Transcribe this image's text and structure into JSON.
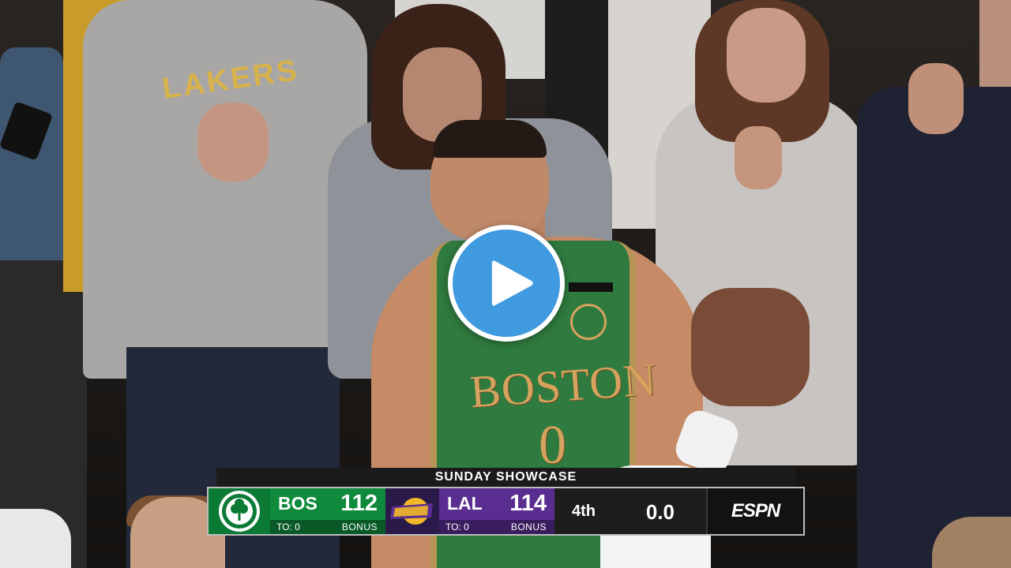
{
  "video": {
    "crowd_shirt_text": "LAKERS",
    "jersey_text": "BOSTON",
    "jersey_number": "0"
  },
  "player_controls": {
    "play_icon": "play-icon",
    "play_button_color": "#3f9adf"
  },
  "scoreboard": {
    "title": "SUNDAY SHOWCASE",
    "away": {
      "abbr": "BOS",
      "score": "112",
      "timeouts": "TO: 0",
      "bonus": "BONUS",
      "logo_icon": "celtics-logo-icon",
      "color": "#0f8a3c"
    },
    "home": {
      "abbr": "LAL",
      "score": "114",
      "timeouts": "TO: 0",
      "bonus": "BONUS",
      "logo_icon": "lakers-logo-icon",
      "color": "#5a2d91"
    },
    "period": "4th",
    "clock": "0.0",
    "network": "ESPN"
  }
}
